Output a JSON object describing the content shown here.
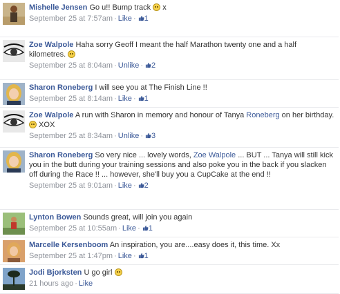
{
  "comments": [
    {
      "author": "Mishelle Jensen",
      "segments": [
        {
          "t": "Go u!! Bump track "
        },
        {
          "emoji": "slight-smile"
        },
        {
          "t": " x"
        }
      ],
      "timestamp": "September 25 at 7:57am",
      "action": "Like",
      "likes": "1",
      "avatar": "person-beach"
    },
    {
      "author": "Zoe Walpole",
      "segments": [
        {
          "t": "Haha sorry Geoff I meant the half Marathon twenty one and a half kilometres. "
        },
        {
          "emoji": "smile"
        }
      ],
      "timestamp": "September 25 at 8:04am",
      "action": "Unlike",
      "likes": "2",
      "avatar": "eye-closeup"
    },
    {
      "author": "Sharon Roneberg",
      "segments": [
        {
          "t": "I will see you at The Finish Line !!"
        }
      ],
      "timestamp": "September 25 at 8:14am",
      "action": "Like",
      "likes": "1",
      "avatar": "blonde-woman"
    },
    {
      "author": "Zoe Walpole",
      "segments": [
        {
          "t": "A run with Sharon in memory and honour of Tanya "
        },
        {
          "mention": "Roneberg"
        },
        {
          "t": " on her birthday. "
        },
        {
          "emoji": "slight-smile"
        },
        {
          "t": " XOX"
        }
      ],
      "timestamp": "September 25 at 8:34am",
      "action": "Unlike",
      "likes": "3",
      "avatar": "eye-closeup"
    },
    {
      "author": "Sharon Roneberg",
      "segments": [
        {
          "t": "So very nice ... lovely words, "
        },
        {
          "mention": "Zoe Walpole"
        },
        {
          "t": " ... BUT ... Tanya will still kick you in the butt during your training sessions and also poke you in the back if you slacken off during the Race !! ... however, she'll buy you a CupCake at the end !!"
        }
      ],
      "timestamp": "September 25 at 9:01am",
      "action": "Like",
      "likes": "2",
      "avatar": "blonde-woman"
    },
    {
      "author": "Lynton Bowen",
      "segments": [
        {
          "t": "Sounds great, will join you again"
        }
      ],
      "timestamp": "September 25 at 10:55am",
      "action": "Like",
      "likes": "1",
      "avatar": "runner-outdoor"
    },
    {
      "author": "Marcelle Kersenboom",
      "segments": [
        {
          "t": "An inspiration, you are....easy does it, this time. Xx"
        }
      ],
      "timestamp": "September 25 at 1:47pm",
      "action": "Like",
      "likes": "1",
      "avatar": "woman-portrait"
    },
    {
      "author": "Jodi Bjorksten",
      "segments": [
        {
          "t": "U go girl "
        },
        {
          "emoji": "smile"
        }
      ],
      "timestamp": "21 hours ago",
      "action": "Like",
      "likes": "",
      "avatar": "silhouette-tree"
    }
  ],
  "colors": {
    "link": "#3b5998",
    "meta": "#90949c",
    "text": "#333333"
  }
}
